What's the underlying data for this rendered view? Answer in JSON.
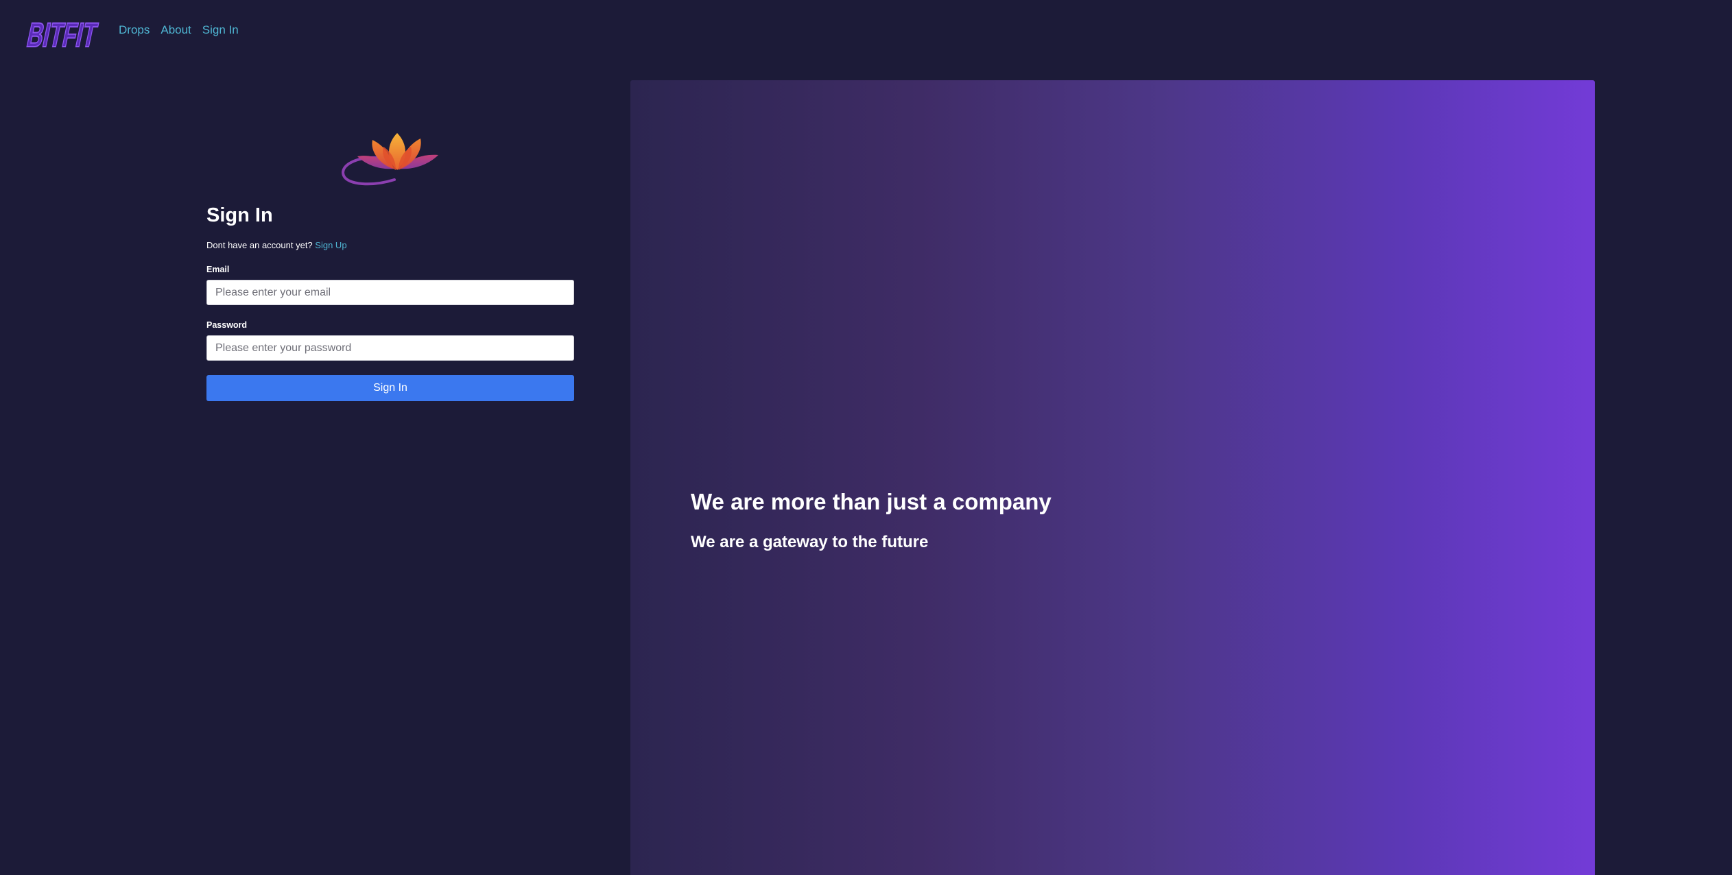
{
  "nav": {
    "logo_text": "BITFIT",
    "links": [
      {
        "label": "Drops"
      },
      {
        "label": "About"
      },
      {
        "label": "Sign In"
      }
    ]
  },
  "signin": {
    "title": "Sign In",
    "signup_prompt": "Dont have an account yet?",
    "signup_link": "Sign Up",
    "email_label": "Email",
    "email_placeholder": "Please enter your email",
    "email_value": "",
    "password_label": "Password",
    "password_placeholder": "Please enter your password",
    "password_value": "",
    "submit_label": "Sign In"
  },
  "hero": {
    "title": "We are more than just a company",
    "subtitle": "We are a gateway to the future"
  },
  "colors": {
    "background": "#1c1b38",
    "link": "#4fb6d3",
    "button": "#3b78ef",
    "logo": "#7a3fe0",
    "hero_gradient_start": "#2c2550",
    "hero_gradient_end": "#733bd7"
  },
  "icons": {
    "logo": "bitfit-logo",
    "lotus": "lotus-icon"
  }
}
